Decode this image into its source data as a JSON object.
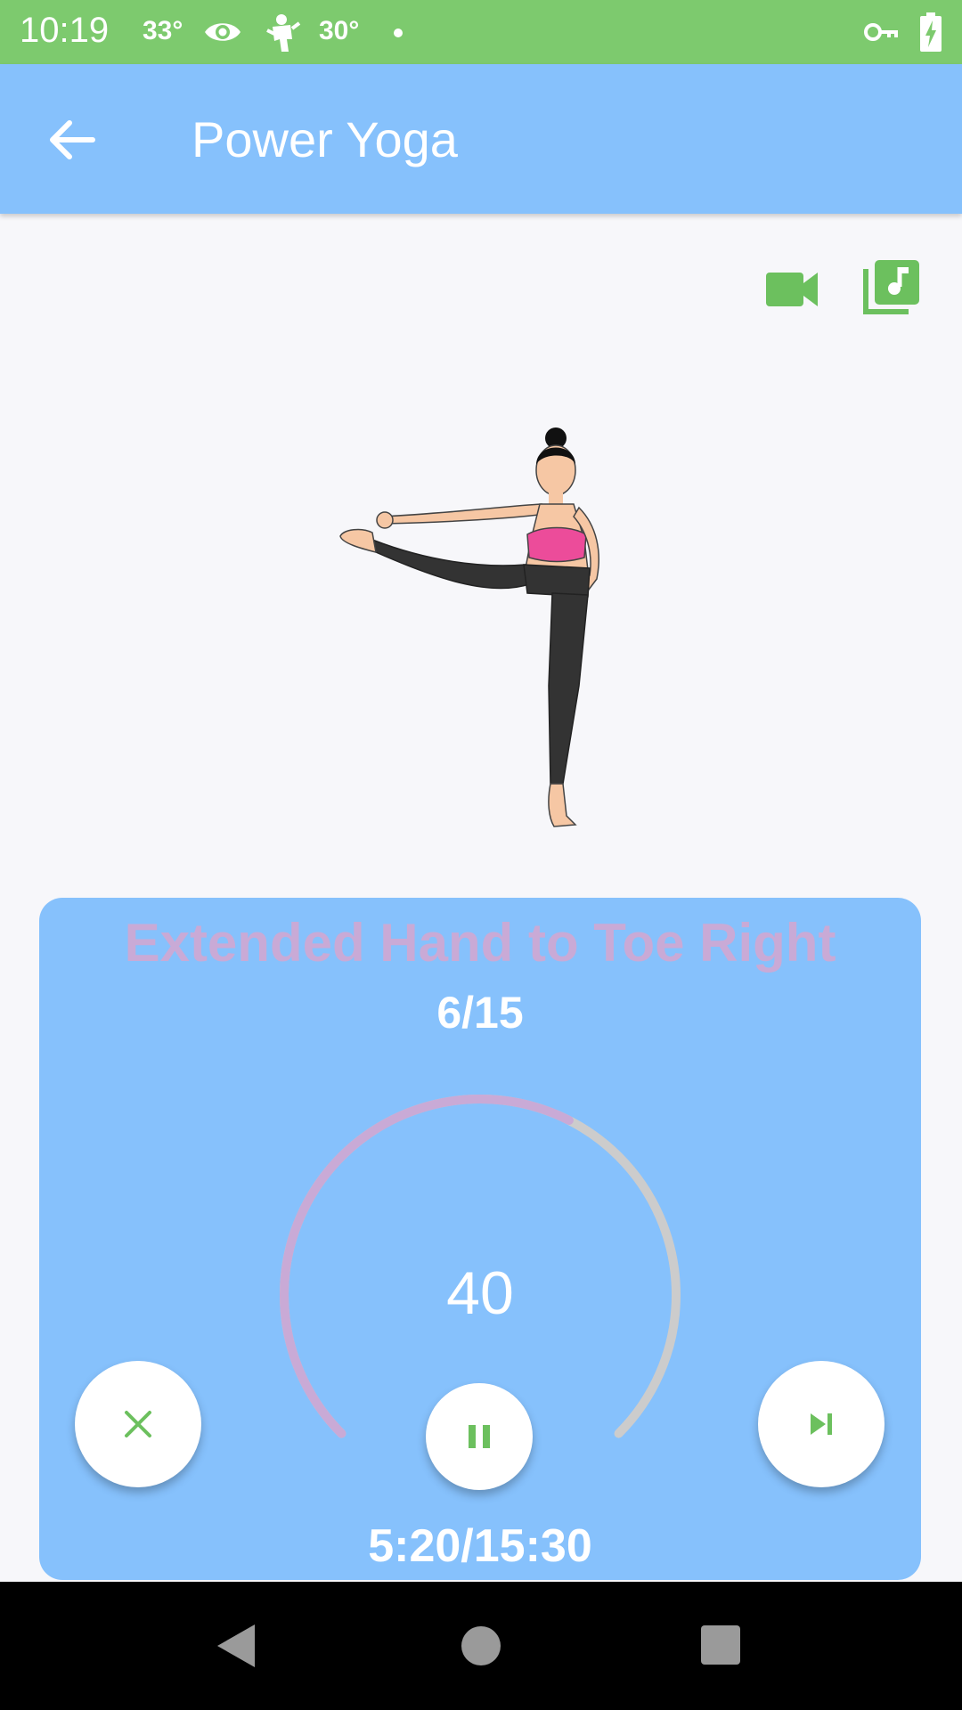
{
  "status_bar": {
    "time": "10:19",
    "temp_1": "33°",
    "temp_2": "30°",
    "icons": [
      "eye-icon",
      "weather-figure-icon",
      "vpn-key-icon",
      "battery-charging-icon"
    ]
  },
  "app_bar": {
    "title": "Power Yoga",
    "back_icon": "arrow-back-icon"
  },
  "actions": {
    "video_icon": "video-camera-icon",
    "music_icon": "music-library-icon"
  },
  "exercise": {
    "name": "Extended Hand to Toe Right",
    "index": "6/15",
    "countdown": "40",
    "countdown_progress": 0.6,
    "elapsed_total": "5:20/15:30"
  },
  "controls": {
    "close_icon": "close-icon",
    "pause_icon": "pause-icon",
    "skip_icon": "skip-next-icon"
  },
  "colors": {
    "status_bar": "#7dca6e",
    "app_bar": "#86c1fc",
    "accent_green": "#6cc05e",
    "progress_purple": "#c9aad6",
    "track_gray": "#cccccc"
  },
  "nav_bar": {
    "back_icon": "triangle-back-icon",
    "home_icon": "circle-home-icon",
    "recents_icon": "square-recents-icon"
  }
}
